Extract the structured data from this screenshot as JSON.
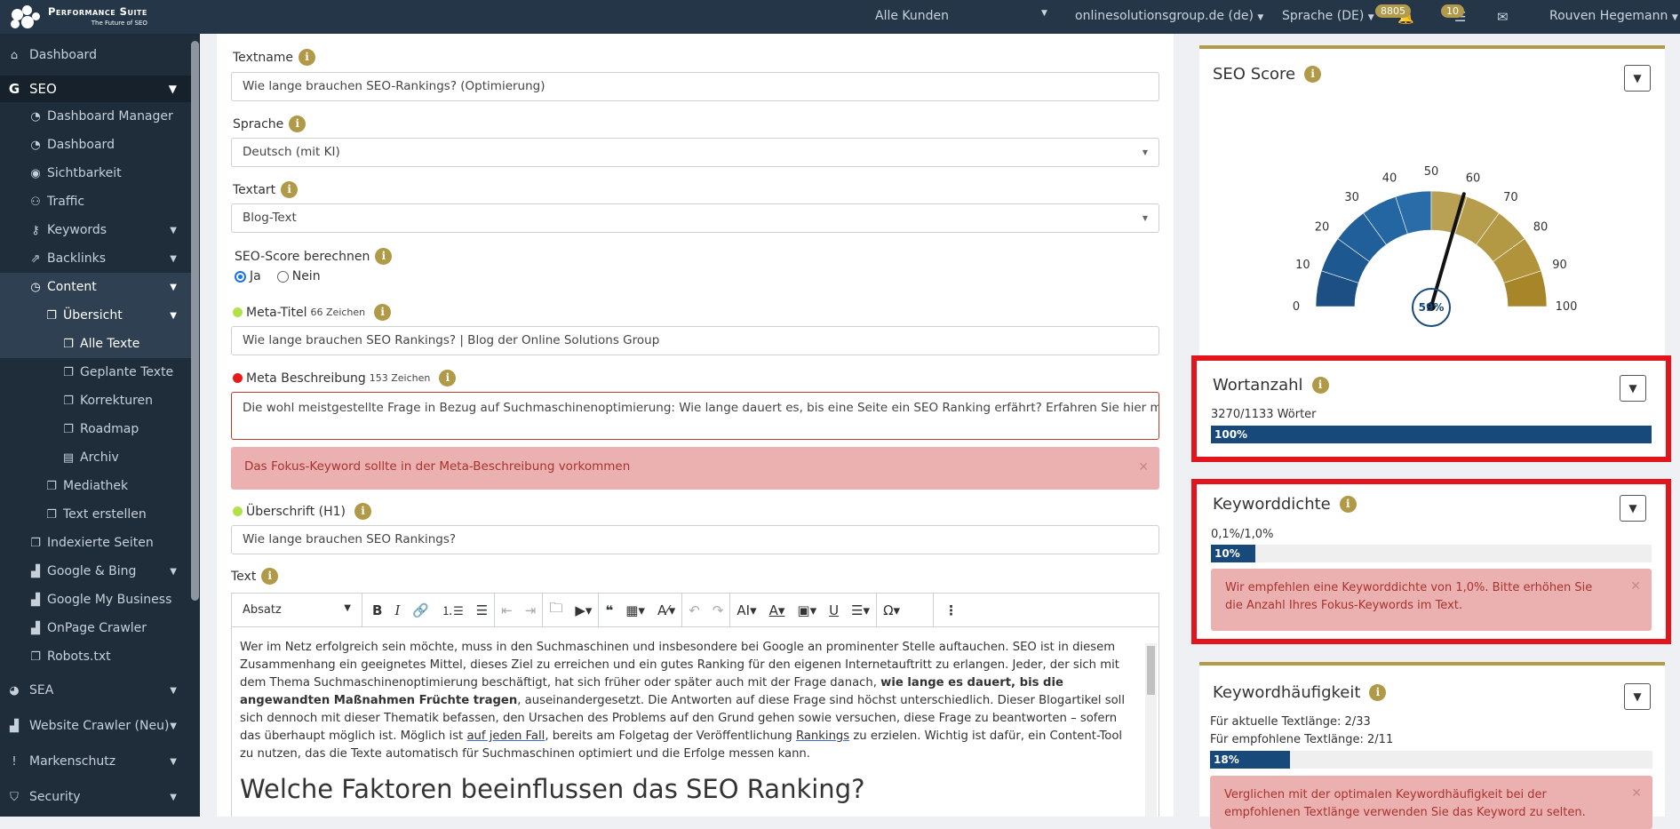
{
  "topbar": {
    "brand": "Performance Suite",
    "tagline": "The Future of SEO",
    "customer_select": "Alle Kunden",
    "domain_select": "onlinesolutionsgroup.de (de)",
    "language_select": "Sprache (DE)",
    "badge_alerts": "8805",
    "badge_tasks": "10",
    "user_name": "Rouven Hegemann"
  },
  "sidebar": {
    "dashboard": "Dashboard",
    "seo": "SEO",
    "dashboard_manager": "Dashboard Manager",
    "seo_dashboard": "Dashboard",
    "sichtbarkeit": "Sichtbarkeit",
    "traffic": "Traffic",
    "keywords": "Keywords",
    "backlinks": "Backlinks",
    "content": "Content",
    "uebersicht": "Übersicht",
    "alle_texte": "Alle Texte",
    "geplante_texte": "Geplante Texte",
    "korrekturen": "Korrekturen",
    "roadmap": "Roadmap",
    "archiv": "Archiv",
    "mediathek": "Mediathek",
    "text_erstellen": "Text erstellen",
    "indexierte_seiten": "Indexierte Seiten",
    "google_bing": "Google & Bing",
    "google_my_business": "Google My Business",
    "onpage_crawler": "OnPage Crawler",
    "robots": "Robots.txt",
    "sea": "SEA",
    "website_crawler": "Website Crawler (Neu)",
    "markenschutz": "Markenschutz",
    "security": "Security"
  },
  "form": {
    "textname_label": "Textname",
    "textname_value": "Wie lange brauchen SEO-Rankings? (Optimierung)",
    "sprache_label": "Sprache",
    "sprache_value": "Deutsch (mit KI)",
    "textart_label": "Textart",
    "textart_value": "Blog-Text",
    "seo_score_label": "SEO-Score berechnen",
    "radio_yes": "Ja",
    "radio_no": "Nein",
    "meta_titel_label": "Meta-Titel",
    "meta_titel_count": "66 Zeichen",
    "meta_titel_value": "Wie lange brauchen SEO Rankings? | Blog der Online Solutions Group",
    "meta_beschreibung_label": "Meta Beschreibung",
    "meta_beschreibung_count": "153 Zeichen",
    "meta_beschreibung_value": "Die wohl meistgestellte Frage in Bezug auf Suchmaschinenoptimierung: Wie lange dauert es, bis eine Seite ein SEO Ranking erfährt? Erfahren Sie hier mehr!",
    "meta_alert": "Das Fokus-Keyword sollte in der Meta-Beschreibung vorkommen",
    "h1_label": "Überschrift (H1)",
    "h1_value": "Wie lange brauchen SEO Rankings?",
    "text_label": "Text"
  },
  "editor": {
    "paragraph_style": "Absatz",
    "p1_a": "Wer im Netz erfolgreich sein möchte, muss in den Suchmaschinen und insbesondere bei Google an prominenter Stelle auftauchen. SEO ist in diesem Zusammenhang ein geeignetes Mittel, dieses Ziel zu erreichen und ein gutes Ranking für den eigenen Internetauftritt zu erlangen. Jeder, der sich mit dem Thema Suchmaschinenoptimierung beschäftigt, hat sich früher oder später auch mit der Frage danach, ",
    "p1_bold": "wie lange es dauert, bis die angewandten Maßnahmen Früchte tragen",
    "p1_b": ", auseinandergesetzt. Die Antworten auf diese Frage sind höchst unterschiedlich. Dieser Blogartikel soll sich dennoch mit dieser Thematik befassen, den Ursachen des Problems auf den Grund gehen sowie versuchen, diese Frage zu beantworten – sofern das überhaupt möglich ist. Möglich ist ",
    "p1_link1": "auf jeden Fall",
    "p1_c": ", bereits am Folgetag der Veröffentlichung ",
    "p1_link2": "Rankings",
    "p1_d": " zu erzielen. Wichtig ist dafür, ein Content-Tool zu nutzen, das die Texte automatisch für Suchmaschinen optimiert und die Erfolge messen kann.",
    "h2": "Welche Faktoren beeinflussen das SEO Ranking?"
  },
  "seo_score": {
    "title": "SEO Score",
    "value": 59,
    "value_label": "59%",
    "ticks": [
      "0",
      "10",
      "20",
      "30",
      "40",
      "50",
      "60",
      "70",
      "80",
      "90",
      "100"
    ]
  },
  "wortanzahl": {
    "title": "Wortanzahl",
    "text": "3270/1133 Wörter",
    "percent": 100,
    "bar_label": "100%"
  },
  "keyworddichte": {
    "title": "Keyworddichte",
    "text": "0,1%/1,0%",
    "percent": 10,
    "bar_label": "10%",
    "alert": "Wir empfehlen eine Keyworddichte von 1,0%. Bitte erhöhen Sie die Anzahl Ihres Fokus-Keywords im Text."
  },
  "keywordhaeufigkeit": {
    "title": "Keywordhäufigkeit",
    "line1": "Für aktuelle Textlänge: 2/33",
    "line2": "Für empfohlene Textlänge: 2/11",
    "percent": 18,
    "bar_label": "18%",
    "alert": "Verglichen mit der optimalen Keywordhäufigkeit bei der empfohlenen Textlänge verwenden Sie das Keyword zu selten."
  },
  "colors": {
    "accent_gold": "#b19a4a",
    "bar_blue": "#17497a",
    "alert_bg": "#ebb0b0",
    "alert_text": "#a8342f",
    "highlight_red": "#e2141c",
    "dot_green": "#b2e24a",
    "dot_red": "#e81919"
  }
}
